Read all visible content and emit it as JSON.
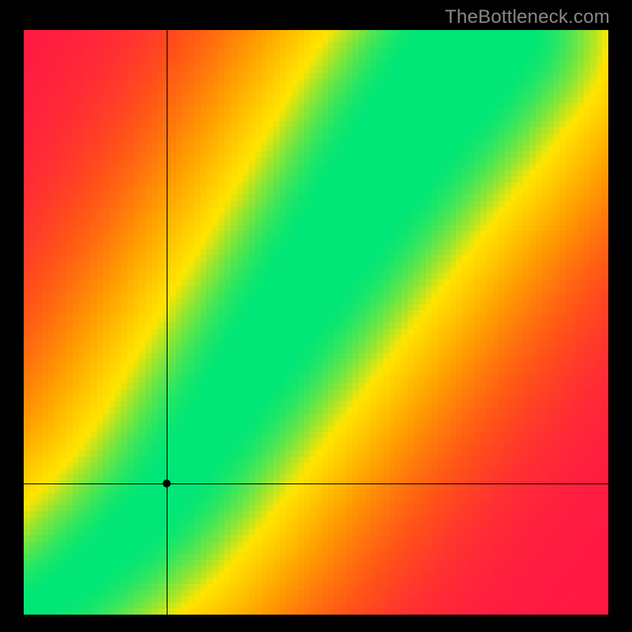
{
  "watermark": "TheBottleneck.com",
  "chart_data": {
    "type": "heatmap",
    "title": "",
    "xlabel": "",
    "ylabel": "",
    "xlim": [
      0,
      1
    ],
    "ylim": [
      0,
      1
    ],
    "grid": false,
    "legend": false,
    "colormap_stops": [
      {
        "t": 0.0,
        "color": "#ff1744"
      },
      {
        "t": 0.22,
        "color": "#ff5218"
      },
      {
        "t": 0.5,
        "color": "#ff9e00"
      },
      {
        "t": 0.78,
        "color": "#ffe500"
      },
      {
        "t": 1.0,
        "color": "#00e676"
      }
    ],
    "marker": {
      "x": 0.245,
      "y": 0.225
    },
    "crosshair": {
      "x": 0.245,
      "y": 0.225
    },
    "ridge": {
      "description": "Approximate centerline of the green optimal band as (x, y) control points in axis-normalized coords (origin bottom-left).",
      "points": [
        [
          0.0,
          0.0
        ],
        [
          0.08,
          0.05
        ],
        [
          0.16,
          0.12
        ],
        [
          0.22,
          0.18
        ],
        [
          0.28,
          0.26
        ],
        [
          0.34,
          0.35
        ],
        [
          0.4,
          0.44
        ],
        [
          0.48,
          0.56
        ],
        [
          0.56,
          0.68
        ],
        [
          0.64,
          0.8
        ],
        [
          0.72,
          0.91
        ],
        [
          0.78,
          1.0
        ]
      ],
      "band_halfwidth_start": 0.006,
      "band_halfwidth_end": 0.08,
      "falloff_sigma": 0.2
    },
    "resolution": 96
  }
}
